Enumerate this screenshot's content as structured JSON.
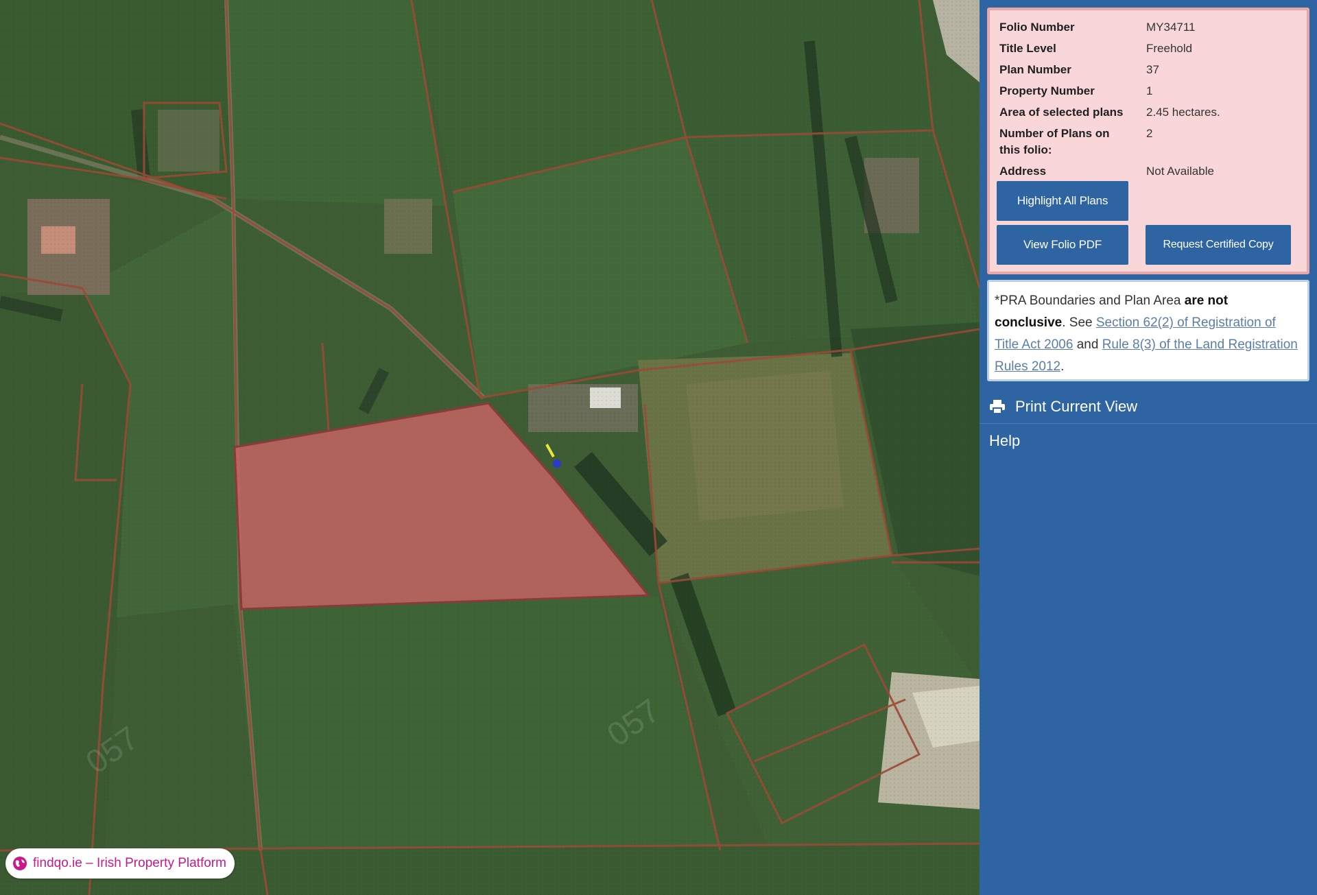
{
  "folio": {
    "fields": [
      {
        "label": "Folio Number",
        "value": "MY34711"
      },
      {
        "label": "Title Level",
        "value": "Freehold"
      },
      {
        "label": "Plan Number",
        "value": "37"
      },
      {
        "label": "Property Number",
        "value": "1"
      },
      {
        "label": "Area of selected plans",
        "value": "2.45 hectares."
      },
      {
        "label": "Number of Plans on this folio:",
        "value": "2"
      },
      {
        "label": "Address",
        "value": "Not Available"
      }
    ],
    "buttons": {
      "highlight": "Highlight All Plans",
      "view_pdf": "View Folio PDF",
      "request_copy": "Request Certified Copy"
    }
  },
  "disclaimer": {
    "prefix": "*PRA Boundaries and Plan Area",
    "bold": "are not conclusive",
    "see": ". See",
    "link1": "Section 62(2) of Registration of Title Act 2006",
    "and": "and",
    "link2": "Rule 8(3) of the Land Registration Rules 2012",
    "suffix": "."
  },
  "menu": {
    "print": "Print Current View",
    "help": "Help"
  },
  "badge": {
    "text": "findqo.ie – Irish Property Platform"
  },
  "map": {
    "parcel_labels": [
      "057",
      "057"
    ]
  },
  "colors": {
    "panel": "#2e64a2",
    "card": "#f9d7d8",
    "highlight_fill": "#c86464",
    "boundary": "#9a4a36",
    "badge_text": "#c8198a"
  }
}
